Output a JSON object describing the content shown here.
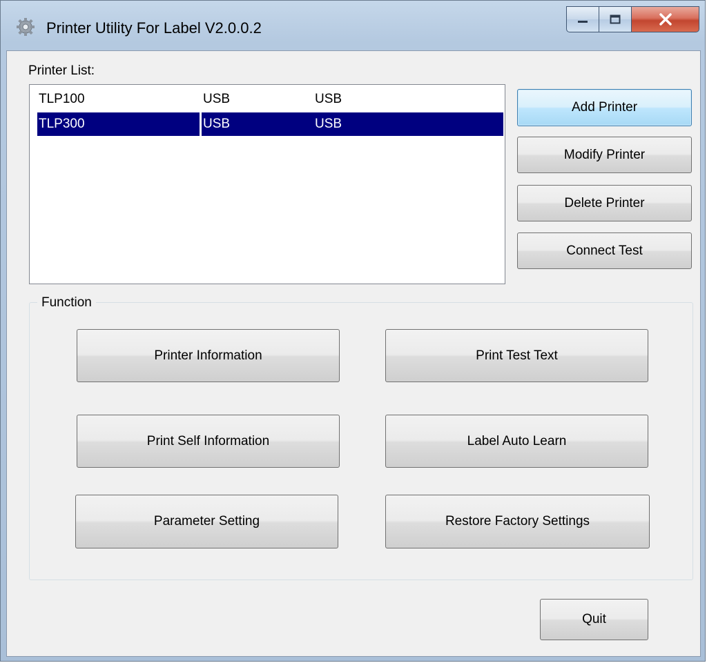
{
  "window": {
    "title": "Printer Utility For Label  V2.0.0.2",
    "icon": "gear-icon"
  },
  "printer_list": {
    "label": "Printer List:",
    "rows": [
      {
        "name": "TLP100",
        "port": "USB",
        "type": "USB",
        "selected": false
      },
      {
        "name": "TLP300",
        "port": "USB",
        "type": "USB",
        "selected": true
      }
    ]
  },
  "side_buttons": {
    "add": "Add Printer",
    "modify": "Modify Printer",
    "delete": "Delete Printer",
    "connect": "Connect Test"
  },
  "function_group": {
    "title": "Function",
    "printer_information": "Printer Information",
    "print_test_text": "Print Test Text",
    "print_self_information": "Print Self Information",
    "label_auto_learn": "Label Auto Learn",
    "parameter_setting": "Parameter Setting",
    "restore_factory_settings": "Restore Factory Settings"
  },
  "footer": {
    "quit": "Quit"
  },
  "colors": {
    "selection": "#000080",
    "client_bg": "#f0f0f0",
    "close_button": "#c24630"
  }
}
